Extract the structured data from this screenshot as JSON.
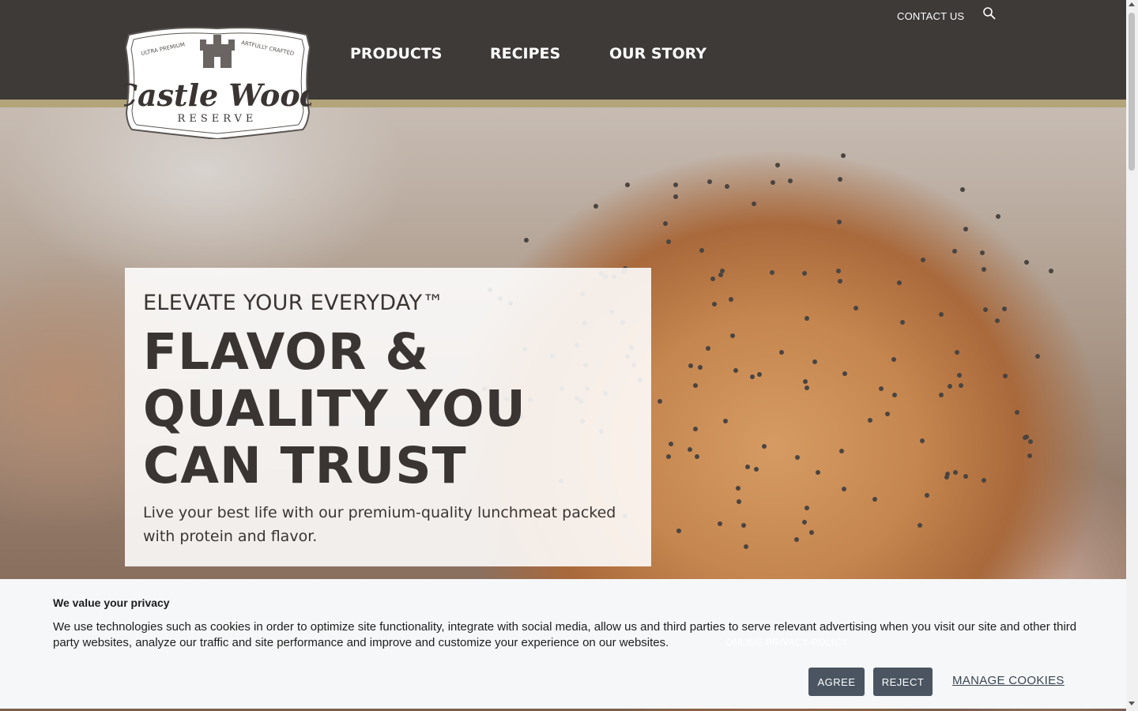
{
  "header": {
    "contact_label": "CONTACT US",
    "nav": [
      {
        "label": "PRODUCTS"
      },
      {
        "label": "RECIPES"
      },
      {
        "label": "OUR STORY"
      }
    ]
  },
  "logo": {
    "top_left": "ULTRA PREMIUM",
    "top_right": "ARTFULLY CRAFTED",
    "brand": "Castle Wood",
    "sub": "RESERVE"
  },
  "hero": {
    "eyebrow": "ELEVATE YOUR EVERYDAY™",
    "headline_line1": "FLAVOR &",
    "headline_line2": "QUALITY YOU",
    "headline_line3": "CAN TRUST",
    "subtext": "Live your best life with our premium-quality lunchmeat packed with protein and flavor."
  },
  "cookie": {
    "title": "We value your privacy",
    "text": "We use technologies such as cookies in order to optimize site functionality, integrate with social media, allow us and third parties to serve relevant advertising when you visit our site and other third party websites, analyze our traffic and site performance and improve and customize your experience on our websites.",
    "privacy_link": "ONLINE PRIVACY POLICY",
    "agree_label": "AGREE",
    "reject_label": "REJECT",
    "manage_label": "MANAGE COOKIES"
  },
  "colors": {
    "header_bg": "#3d3a38",
    "accent_stripe": "#b3a47a",
    "button_bg": "#4a5561"
  },
  "icons": {
    "search": "search-icon"
  }
}
